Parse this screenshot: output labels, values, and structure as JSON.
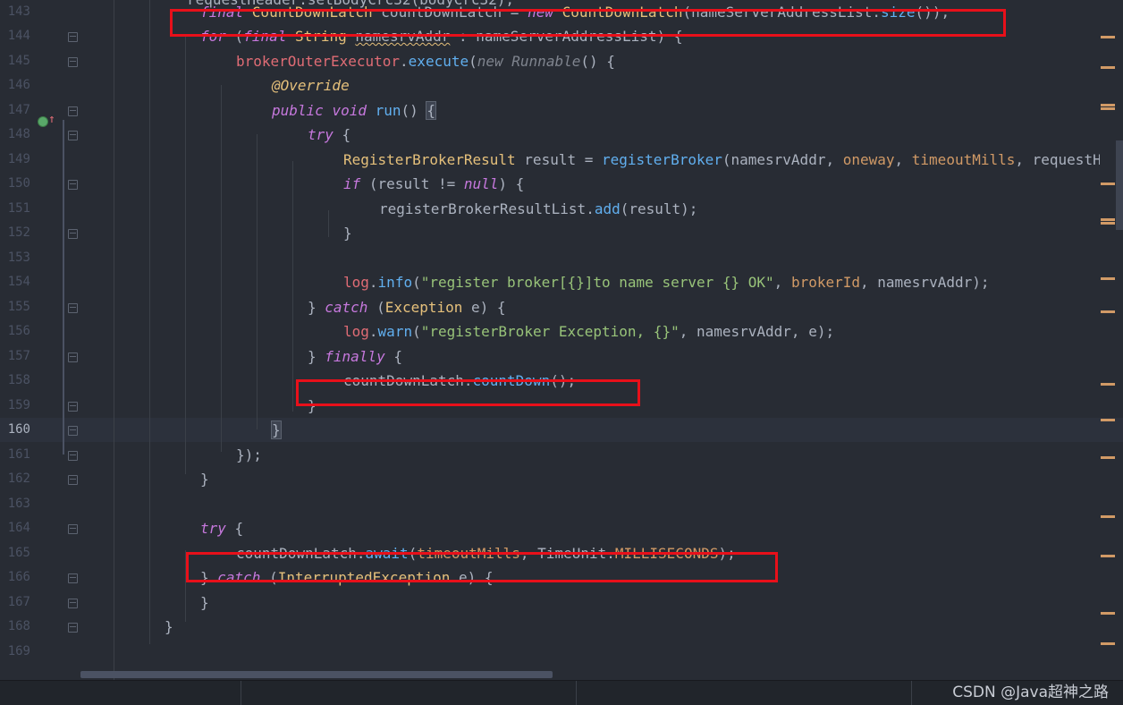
{
  "editor": {
    "lines": [
      {
        "number": "143",
        "indent": 3,
        "tokens": [
          {
            "t": "final ",
            "c": "kw"
          },
          {
            "t": "CountDownLatch ",
            "c": "ty"
          },
          {
            "t": "countDownLatch = "
          },
          {
            "t": "new ",
            "c": "kw"
          },
          {
            "t": "CountDownLatch",
            "c": "ty"
          },
          {
            "t": "(nameServerAddressList."
          },
          {
            "t": "size",
            "c": "fn"
          },
          {
            "t": "());"
          }
        ]
      },
      {
        "number": "144",
        "indent": 3,
        "tokens": [
          {
            "t": "for ",
            "c": "kw"
          },
          {
            "t": "("
          },
          {
            "t": "final ",
            "c": "kw"
          },
          {
            "t": "String ",
            "c": "ty"
          },
          {
            "t": "namesrvAddr",
            "c": "squig"
          },
          {
            "t": " : nameServerAddressList) {"
          }
        ]
      },
      {
        "number": "145",
        "indent": 4,
        "tokens": [
          {
            "t": "brokerOuterExecutor",
            "c": "fld"
          },
          {
            "t": "."
          },
          {
            "t": "execute",
            "c": "fn"
          },
          {
            "t": "("
          },
          {
            "t": "new ",
            "c": "dim"
          },
          {
            "t": "Runnable",
            "c": "dim"
          },
          {
            "t": "() {"
          }
        ]
      },
      {
        "number": "146",
        "indent": 5,
        "tokens": [
          {
            "t": "@Override",
            "c": "ann"
          }
        ]
      },
      {
        "number": "147",
        "indent": 5,
        "tokens": [
          {
            "t": "public ",
            "c": "kw"
          },
          {
            "t": "void ",
            "c": "kw"
          },
          {
            "t": "run",
            "c": "fn"
          },
          {
            "t": "() "
          },
          {
            "t": "{",
            "c": "brkt"
          }
        ]
      },
      {
        "number": "148",
        "indent": 6,
        "tokens": [
          {
            "t": "try ",
            "c": "kw"
          },
          {
            "t": "{"
          }
        ]
      },
      {
        "number": "149",
        "indent": 7,
        "tokens": [
          {
            "t": "RegisterBrokerResult ",
            "c": "ty"
          },
          {
            "t": "result = "
          },
          {
            "t": "registerBroker",
            "c": "fn"
          },
          {
            "t": "(namesrvAddr, "
          },
          {
            "t": "oneway",
            "c": "par"
          },
          {
            "t": ", "
          },
          {
            "t": "timeoutMills",
            "c": "par"
          },
          {
            "t": ", requestH"
          }
        ]
      },
      {
        "number": "150",
        "indent": 7,
        "tokens": [
          {
            "t": "if ",
            "c": "kw"
          },
          {
            "t": "(result != "
          },
          {
            "t": "null",
            "c": "kw"
          },
          {
            "t": ") {"
          }
        ]
      },
      {
        "number": "151",
        "indent": 8,
        "tokens": [
          {
            "t": "registerBrokerResultList."
          },
          {
            "t": "add",
            "c": "fn"
          },
          {
            "t": "(result);"
          }
        ]
      },
      {
        "number": "152",
        "indent": 7,
        "tokens": [
          {
            "t": "}"
          }
        ]
      },
      {
        "number": "153",
        "indent": 0,
        "tokens": []
      },
      {
        "number": "154",
        "indent": 7,
        "tokens": [
          {
            "t": "log",
            "c": "fld"
          },
          {
            "t": "."
          },
          {
            "t": "info",
            "c": "fn"
          },
          {
            "t": "("
          },
          {
            "t": "\"register broker[{}]to name server {} OK\"",
            "c": "str"
          },
          {
            "t": ", "
          },
          {
            "t": "brokerId",
            "c": "par"
          },
          {
            "t": ", namesrvAddr);"
          }
        ]
      },
      {
        "number": "155",
        "indent": 6,
        "tokens": [
          {
            "t": "} "
          },
          {
            "t": "catch ",
            "c": "kw"
          },
          {
            "t": "("
          },
          {
            "t": "Exception ",
            "c": "ty"
          },
          {
            "t": "e) {"
          }
        ]
      },
      {
        "number": "156",
        "indent": 7,
        "tokens": [
          {
            "t": "log",
            "c": "fld"
          },
          {
            "t": "."
          },
          {
            "t": "warn",
            "c": "fn"
          },
          {
            "t": "("
          },
          {
            "t": "\"registerBroker Exception, {}\"",
            "c": "str"
          },
          {
            "t": ", namesrvAddr, e);"
          }
        ]
      },
      {
        "number": "157",
        "indent": 6,
        "tokens": [
          {
            "t": "} "
          },
          {
            "t": "finally ",
            "c": "kw"
          },
          {
            "t": "{"
          }
        ]
      },
      {
        "number": "158",
        "indent": 7,
        "tokens": [
          {
            "t": "countDownLatch."
          },
          {
            "t": "countDown",
            "c": "fn"
          },
          {
            "t": "();"
          }
        ]
      },
      {
        "number": "159",
        "indent": 6,
        "tokens": [
          {
            "t": "}"
          }
        ]
      },
      {
        "number": "160",
        "indent": 5,
        "tokens": [
          {
            "t": "}",
            "c": "brkt"
          }
        ]
      },
      {
        "number": "161",
        "indent": 4,
        "tokens": [
          {
            "t": "});"
          }
        ]
      },
      {
        "number": "162",
        "indent": 3,
        "tokens": [
          {
            "t": "}"
          }
        ]
      },
      {
        "number": "163",
        "indent": 0,
        "tokens": []
      },
      {
        "number": "164",
        "indent": 3,
        "tokens": [
          {
            "t": "try ",
            "c": "kw"
          },
          {
            "t": "{"
          }
        ]
      },
      {
        "number": "165",
        "indent": 4,
        "tokens": [
          {
            "t": "countDownLatch."
          },
          {
            "t": "await",
            "c": "fn"
          },
          {
            "t": "("
          },
          {
            "t": "timeoutMills",
            "c": "par"
          },
          {
            "t": ", TimeUnit."
          },
          {
            "t": "MILLISECONDS",
            "c": "cst"
          },
          {
            "t": ");"
          }
        ]
      },
      {
        "number": "166",
        "indent": 3,
        "tokens": [
          {
            "t": "} "
          },
          {
            "t": "catch",
            "c": "kw"
          },
          {
            "t": " ("
          },
          {
            "t": "InterruptedException ",
            "c": "ty"
          },
          {
            "t": "e) {"
          }
        ]
      },
      {
        "number": "167",
        "indent": 3,
        "tokens": [
          {
            "t": "}"
          }
        ]
      },
      {
        "number": "168",
        "indent": 2,
        "tokens": [
          {
            "t": "}"
          }
        ]
      },
      {
        "number": "169",
        "indent": 0,
        "tokens": []
      }
    ],
    "partial_top_line": "requestHeader.setBodyCrc32(bodyCrc32);",
    "current_line": "160",
    "highlighted_lines": [
      "143",
      "158",
      "165"
    ]
  },
  "watermark": "CSDN @Java超神之路",
  "colors": {
    "background": "#282c34",
    "highlight_border": "#e8101a",
    "keyword": "#c678dd",
    "type": "#e5c07b",
    "function": "#61afef",
    "string": "#98c379"
  }
}
